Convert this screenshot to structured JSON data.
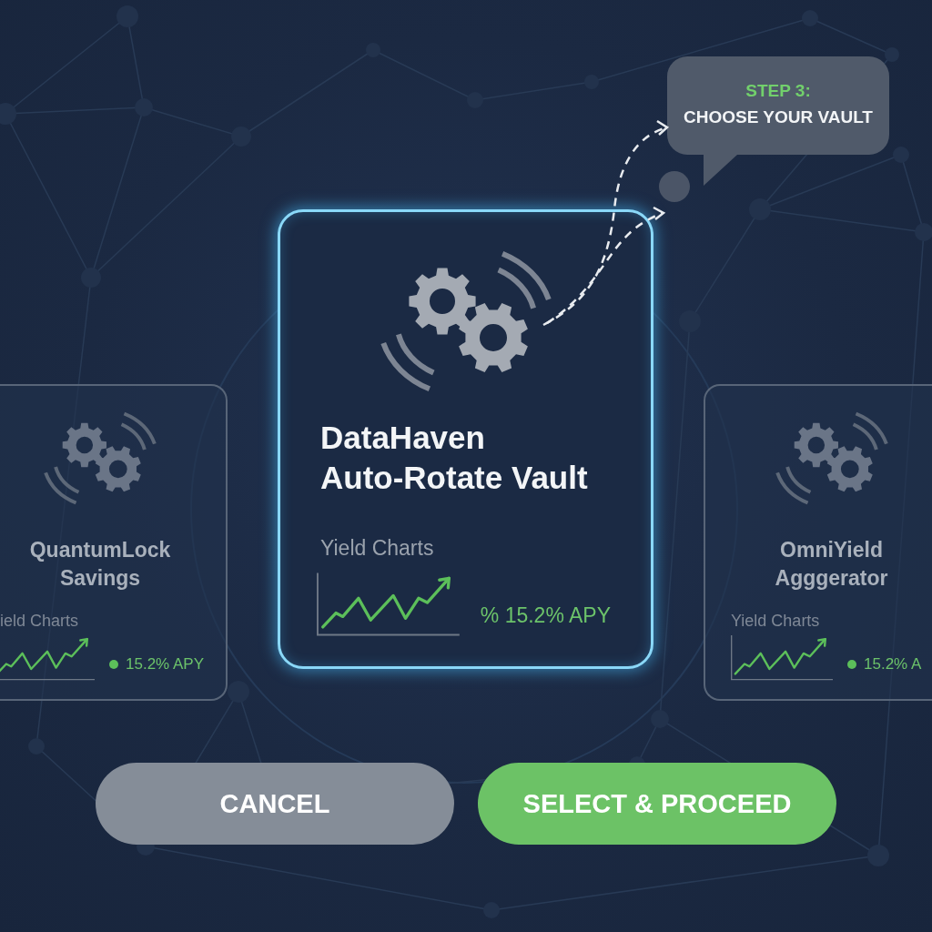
{
  "tooltip": {
    "step": "STEP 3:",
    "text": "CHOOSE YOUR VAULT"
  },
  "cards": [
    {
      "title": "QuantumLock\nSavings",
      "chart_label": "ield Charts",
      "apy": "15.2% APY",
      "selected": false
    },
    {
      "title": "DataHaven\nAuto-Rotate Vault",
      "chart_label": "Yield Charts",
      "apy": "% 15.2% APY",
      "selected": true
    },
    {
      "title": "OmniYield\nAgggerator",
      "chart_label": "Yield Charts",
      "apy": "15.2% A",
      "selected": false
    }
  ],
  "buttons": [
    {
      "label": "CANCEL",
      "kind": "secondary"
    },
    {
      "label": "SELECT & PROCEED",
      "kind": "primary"
    }
  ]
}
